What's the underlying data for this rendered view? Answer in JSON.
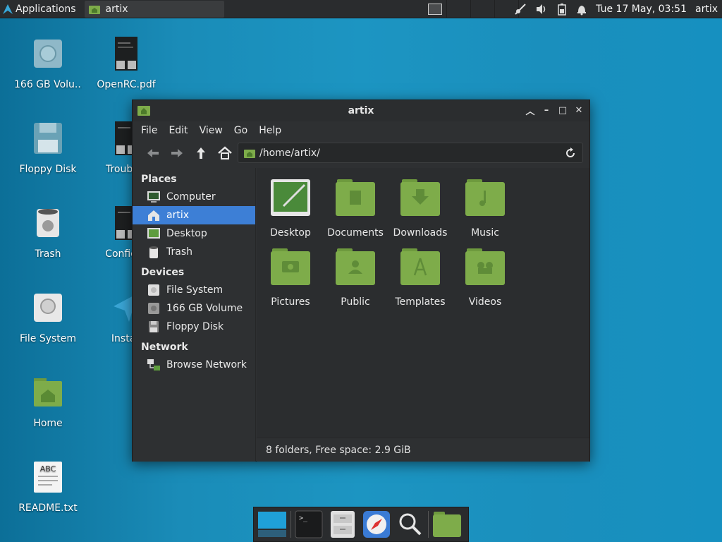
{
  "panel": {
    "apps_label": "Applications",
    "task_label": "artix",
    "clock": "Tue 17 May, 03:51",
    "user": "artix"
  },
  "desktop": {
    "icons": [
      {
        "label": "166 GB Volu...",
        "icon": "drive-icon"
      },
      {
        "label": "OpenRC.pdf",
        "icon": "pdf-icon"
      },
      {
        "label": "Floppy Disk",
        "icon": "floppy-icon"
      },
      {
        "label": "Troubles",
        "icon": "document-icon"
      },
      {
        "label": "Trash",
        "icon": "trash-icon"
      },
      {
        "label": "Configur",
        "icon": "document-icon"
      },
      {
        "label": "File System",
        "icon": "drive-icon"
      },
      {
        "label": "Install",
        "icon": "installer-icon"
      },
      {
        "label": "Home",
        "icon": "home-folder-icon"
      },
      {
        "label": "README.txt",
        "icon": "text-file-icon"
      }
    ]
  },
  "window": {
    "title": "artix",
    "menu": [
      "File",
      "Edit",
      "View",
      "Go",
      "Help"
    ],
    "path": "/home/artix/",
    "sidebar": {
      "places_header": "Places",
      "places": [
        "Computer",
        "artix",
        "Desktop",
        "Trash"
      ],
      "devices_header": "Devices",
      "devices": [
        "File System",
        "166 GB Volume",
        "Floppy Disk"
      ],
      "network_header": "Network",
      "network": [
        "Browse Network"
      ]
    },
    "folders": [
      "Desktop",
      "Documents",
      "Downloads",
      "Music",
      "Pictures",
      "Public",
      "Templates",
      "Videos"
    ],
    "status": "8 folders, Free space: 2.9 GiB"
  },
  "colors": {
    "folder_green": "#7eac4a",
    "selection_blue": "#3d7fd6",
    "panel_bg": "#2a2c2e"
  }
}
